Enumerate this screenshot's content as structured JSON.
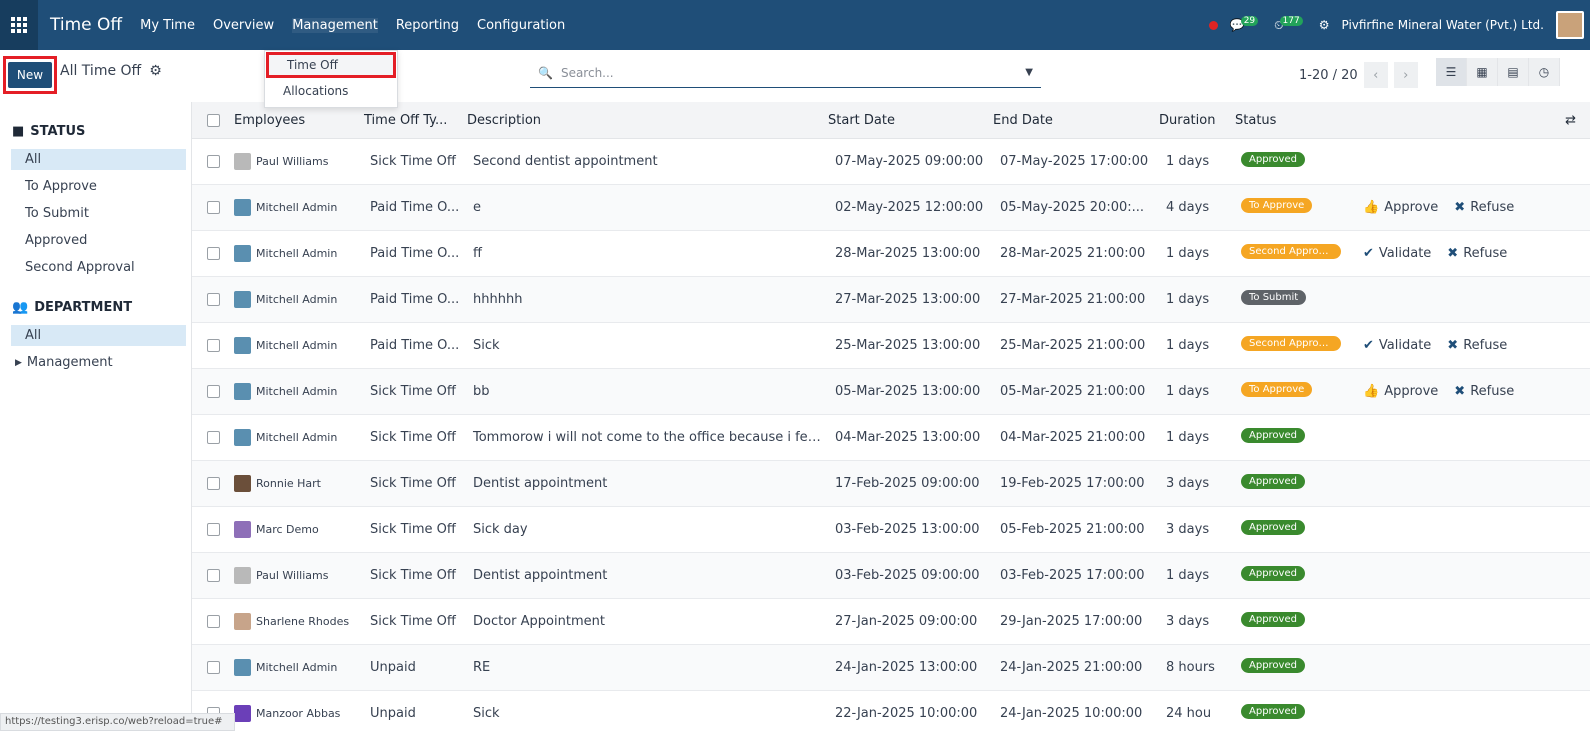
{
  "topbar": {
    "app_title": "Time Off",
    "menu": [
      "My Time",
      "Overview",
      "Management",
      "Reporting",
      "Configuration"
    ],
    "chat_count": "29",
    "activity_count": "177",
    "company": "Pivfirfine Mineral Water (Pvt.) Ltd."
  },
  "control": {
    "new_label": "New",
    "breadcrumb": "All Time Off",
    "search_placeholder": "Search...",
    "pager": "1-20 / 20"
  },
  "dropdown": {
    "items": [
      "Time Off",
      "Allocations"
    ]
  },
  "sidebar": {
    "status_title": "STATUS",
    "status_items": [
      "All",
      "To Approve",
      "To Submit",
      "Approved",
      "Second Approval"
    ],
    "dept_title": "DEPARTMENT",
    "dept_items": [
      "All",
      "Management"
    ]
  },
  "table": {
    "headers": [
      "Employees",
      "Time Off Ty...",
      "Description",
      "Start Date",
      "End Date",
      "Duration",
      "Status"
    ],
    "rows": [
      {
        "emp": "Paul Williams",
        "type": "Sick Time Off",
        "desc": "Second dentist appointment",
        "start": "07-May-2025 09:00:00",
        "end": "07-May-2025 17:00:00",
        "dur": "1 days",
        "status": "Approved",
        "a1": "",
        "a2": ""
      },
      {
        "emp": "Mitchell Admin",
        "type": "Paid Time O...",
        "desc": "e",
        "start": "02-May-2025 12:00:00",
        "end": "05-May-2025 20:00:...",
        "dur": "4 days",
        "status": "To Approve",
        "a1": "Approve",
        "a2": "Refuse"
      },
      {
        "emp": "Mitchell Admin",
        "type": "Paid Time O...",
        "desc": "ff",
        "start": "28-Mar-2025 13:00:00",
        "end": "28-Mar-2025 21:00:00",
        "dur": "1 days",
        "status": "Second Approv...",
        "a1": "Validate",
        "a2": "Refuse"
      },
      {
        "emp": "Mitchell Admin",
        "type": "Paid Time O...",
        "desc": "hhhhhh",
        "start": "27-Mar-2025 13:00:00",
        "end": "27-Mar-2025 21:00:00",
        "dur": "1 days",
        "status": "To Submit",
        "a1": "",
        "a2": ""
      },
      {
        "emp": "Mitchell Admin",
        "type": "Paid Time O...",
        "desc": "Sick",
        "start": "25-Mar-2025 13:00:00",
        "end": "25-Mar-2025 21:00:00",
        "dur": "1 days",
        "status": "Second Approv...",
        "a1": "Validate",
        "a2": "Refuse"
      },
      {
        "emp": "Mitchell Admin",
        "type": "Sick Time Off",
        "desc": "bb",
        "start": "05-Mar-2025 13:00:00",
        "end": "05-Mar-2025 21:00:00",
        "dur": "1 days",
        "status": "To Approve",
        "a1": "Approve",
        "a2": "Refuse"
      },
      {
        "emp": "Mitchell Admin",
        "type": "Sick Time Off",
        "desc": "Tommorow i will not come to the office because i feel ...",
        "start": "04-Mar-2025 13:00:00",
        "end": "04-Mar-2025 21:00:00",
        "dur": "1 days",
        "status": "Approved",
        "a1": "",
        "a2": ""
      },
      {
        "emp": "Ronnie Hart",
        "type": "Sick Time Off",
        "desc": "Dentist appointment",
        "start": "17-Feb-2025 09:00:00",
        "end": "19-Feb-2025 17:00:00",
        "dur": "3 days",
        "status": "Approved",
        "a1": "",
        "a2": ""
      },
      {
        "emp": "Marc Demo",
        "type": "Sick Time Off",
        "desc": "Sick day",
        "start": "03-Feb-2025 13:00:00",
        "end": "05-Feb-2025 21:00:00",
        "dur": "3 days",
        "status": "Approved",
        "a1": "",
        "a2": ""
      },
      {
        "emp": "Paul Williams",
        "type": "Sick Time Off",
        "desc": "Dentist appointment",
        "start": "03-Feb-2025 09:00:00",
        "end": "03-Feb-2025 17:00:00",
        "dur": "1 days",
        "status": "Approved",
        "a1": "",
        "a2": ""
      },
      {
        "emp": "Sharlene Rhodes",
        "type": "Sick Time Off",
        "desc": "Doctor Appointment",
        "start": "27-Jan-2025 09:00:00",
        "end": "29-Jan-2025 17:00:00",
        "dur": "3 days",
        "status": "Approved",
        "a1": "",
        "a2": ""
      },
      {
        "emp": "Mitchell Admin",
        "type": "Unpaid",
        "desc": "RE",
        "start": "24-Jan-2025 13:00:00",
        "end": "24-Jan-2025 21:00:00",
        "dur": "8 hours",
        "status": "Approved",
        "a1": "",
        "a2": ""
      },
      {
        "emp": "Manzoor Abbas",
        "type": "Unpaid",
        "desc": "Sick",
        "start": "22-Jan-2025 10:00:00",
        "end": "24-Jan-2025 10:00:00",
        "dur": "24 hou",
        "status": "Approved",
        "a1": "",
        "a2": ""
      }
    ]
  },
  "status_colors": {
    "Approved": "#3a8a2e",
    "To Approve": "#f5a623",
    "Second Approv...": "#f5a623",
    "To Submit": "#5f6368"
  },
  "status_url": "https://testing3.erisp.co/web?reload=true#"
}
